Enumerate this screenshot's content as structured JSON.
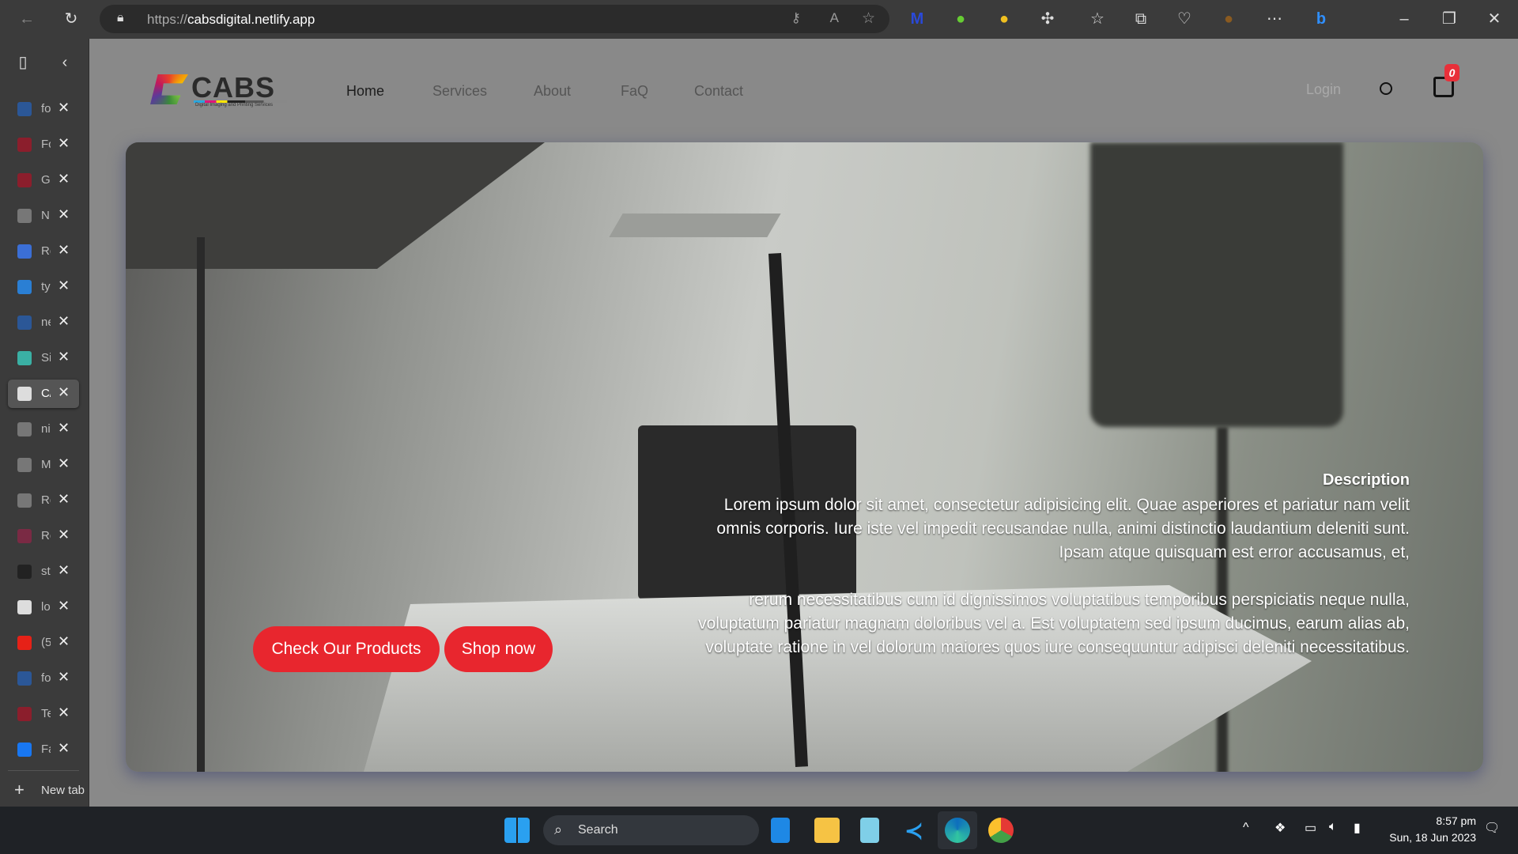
{
  "browser": {
    "url_protocol": "https://",
    "url_host": "cabsdigital.netlify.app"
  },
  "tabs": [
    {
      "label": "fo",
      "color": "#2b5797"
    },
    {
      "label": "Fc",
      "color": "#8b1e2c"
    },
    {
      "label": "G",
      "color": "#8b1e2c"
    },
    {
      "label": "N",
      "color": "#777"
    },
    {
      "label": "Re",
      "color": "#3b6fd6"
    },
    {
      "label": "ty",
      "color": "#2a7fd4"
    },
    {
      "label": "ne",
      "color": "#2b5797"
    },
    {
      "label": "Si",
      "color": "#3ab0a4"
    },
    {
      "label": "C/",
      "color": "#ddd",
      "active": true
    },
    {
      "label": "ni",
      "color": "#777"
    },
    {
      "label": "M",
      "color": "#777"
    },
    {
      "label": "Re",
      "color": "#777"
    },
    {
      "label": "Re",
      "color": "#7a2a44"
    },
    {
      "label": "st",
      "color": "#222"
    },
    {
      "label": "lo",
      "color": "#ddd"
    },
    {
      "label": "(5",
      "color": "#e62117"
    },
    {
      "label": "fo",
      "color": "#2b5797"
    },
    {
      "label": "Te",
      "color": "#8b1e2c"
    },
    {
      "label": "Fa",
      "color": "#1877f2"
    }
  ],
  "new_tab": "New tab",
  "site": {
    "logo_text": "CABS",
    "logo_tagline": "Digital Imaging and Printing Services",
    "nav": [
      "Home",
      "Services",
      "About",
      "FaQ",
      "Contact"
    ],
    "login": "Login",
    "cart_count": "0",
    "description_title": "Description",
    "description_lines": [
      "Lorem ipsum dolor sit amet, consectetur adipisicing elit. Quae asperiores et pariatur nam velit",
      "omnis corporis. Iure iste vel impedit recusandae nulla, animi distinctio laudantium deleniti sunt.",
      "Ipsam atque quisquam est error accusamus, et,",
      "rerum necessitatibus cum id dignissimos voluptatibus temporibus perspiciatis neque nulla,",
      "voluptatum pariatur magnam doloribus vel a. Est voluptatem sed ipsum ducimus, earum alias ab,",
      "voluptate ratione in vel dolorum maiores quos iure consequuntur adipisci deleniti necessitatibus."
    ],
    "btn_products": "Check Our Products",
    "btn_shop": "Shop now",
    "accent": "#e8262e"
  },
  "taskbar": {
    "search": "Search",
    "time": "8:57 pm",
    "date": "Sun, 18 Jun 2023"
  }
}
